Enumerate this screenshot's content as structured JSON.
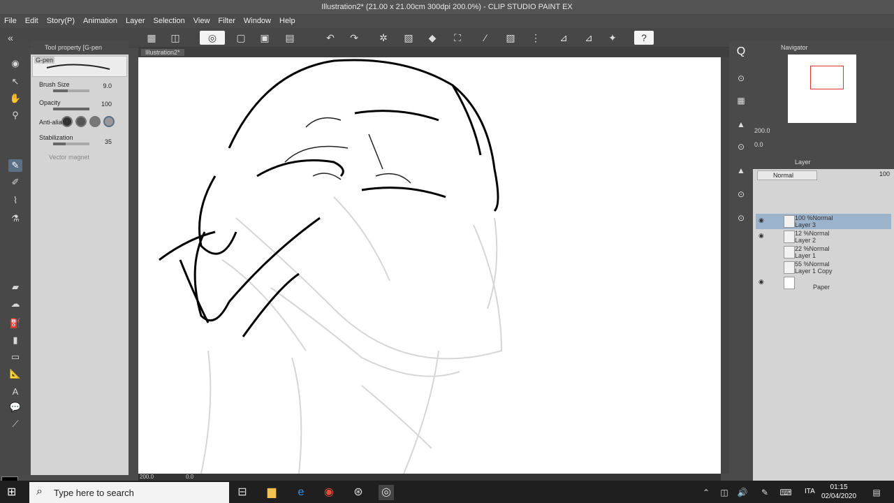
{
  "window": {
    "title": "Illustration2* (21.00 x 21.00cm 300dpi 200.0%) - CLIP STUDIO PAINT EX"
  },
  "menu": [
    "File",
    "Edit",
    "Story(P)",
    "Animation",
    "Layer",
    "Selection",
    "View",
    "Filter",
    "Window",
    "Help"
  ],
  "canvas_tab": {
    "label": "Illustration2*"
  },
  "tool_property": {
    "title": "Tool property [G-pen",
    "brush_name": "G-pen",
    "brush_size_label": "Brush Size",
    "brush_size_value": "9.0",
    "opacity_label": "Opacity",
    "opacity_value": "100",
    "anti_alias_label": "Anti-alias",
    "stabilization_label": "Stabilization",
    "stabilization_value": "35",
    "vector_magnet_label": "Vector magnet"
  },
  "navigator": {
    "title": "Navigator",
    "zoom": "200.0",
    "rotation": "0.0"
  },
  "layer_panel": {
    "title": "Layer",
    "blend_mode": "Normal",
    "opacity": "100",
    "layers": [
      {
        "meta": "100 %Normal",
        "name": "Layer 3",
        "visible": true,
        "selected": true
      },
      {
        "meta": "12 %Normal",
        "name": "Layer 2",
        "visible": true,
        "selected": false
      },
      {
        "meta": "22 %Normal",
        "name": "Layer 1",
        "visible": false,
        "selected": false
      },
      {
        "meta": "55 %Normal",
        "name": "Layer 1 Copy",
        "visible": false,
        "selected": false
      },
      {
        "meta": "",
        "name": "Paper",
        "visible": true,
        "selected": false
      }
    ]
  },
  "status": {
    "zoom": "200.0",
    "rotation": "0.0"
  },
  "taskbar": {
    "search_placeholder": "Type here to search",
    "language": "ITA",
    "time": "01:15",
    "date": "02/04/2020"
  }
}
